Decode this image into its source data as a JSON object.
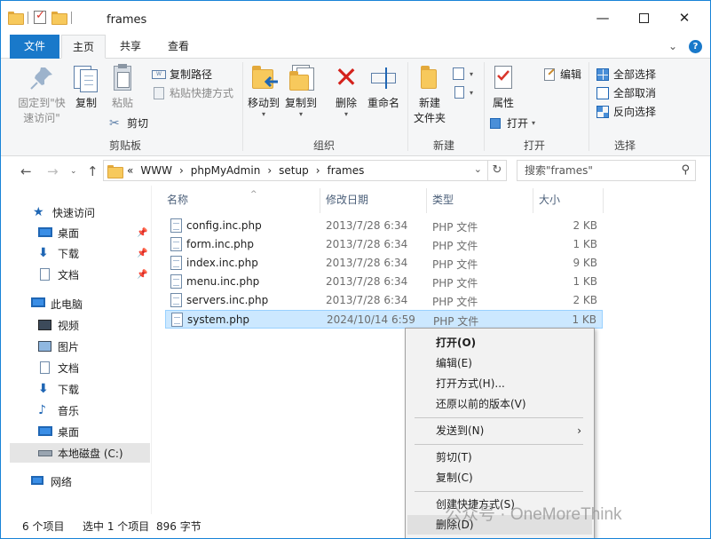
{
  "window": {
    "title": "frames"
  },
  "controls": {
    "min": "—",
    "close": "✕"
  },
  "ribbon_tabs": [
    {
      "label": "文件"
    },
    {
      "label": "主页"
    },
    {
      "label": "共享"
    },
    {
      "label": "查看"
    }
  ],
  "ribbon": {
    "clipboard": {
      "pin_label_1": "固定到\"快",
      "pin_label_2": "速访问\"",
      "copy": "复制",
      "paste": "粘贴",
      "copy_path": "复制路径",
      "paste_shortcut": "粘贴快捷方式",
      "cut": "剪切",
      "group": "剪贴板"
    },
    "organize": {
      "move_to": "移动到",
      "copy_to": "复制到",
      "delete": "删除",
      "rename": "重命名",
      "group": "组织"
    },
    "new": {
      "new_folder_1": "新建",
      "new_folder_2": "文件夹",
      "group": "新建"
    },
    "open": {
      "properties": "属性",
      "open": "打开",
      "edit": "编辑",
      "group": "打开"
    },
    "select": {
      "select_all": "全部选择",
      "select_none": "全部取消",
      "invert": "反向选择",
      "group": "选择"
    }
  },
  "nav": {
    "back": "←",
    "forward": "→",
    "up": "↑",
    "breadcrumb": [
      "«",
      "WWW",
      "›",
      "phpMyAdmin",
      "›",
      "setup",
      "›",
      "frames"
    ],
    "search_placeholder": "搜索\"frames\""
  },
  "sidebar": {
    "items": [
      {
        "label": "快速访问"
      },
      {
        "label": "桌面"
      },
      {
        "label": "下载"
      },
      {
        "label": "文档"
      },
      {
        "label": "此电脑"
      },
      {
        "label": "视频"
      },
      {
        "label": "图片"
      },
      {
        "label": "文档"
      },
      {
        "label": "下载"
      },
      {
        "label": "音乐"
      },
      {
        "label": "桌面"
      },
      {
        "label": "本地磁盘 (C:)"
      },
      {
        "label": "网络"
      }
    ]
  },
  "columns": {
    "name": "名称",
    "date": "修改日期",
    "type": "类型",
    "size": "大小"
  },
  "files": [
    {
      "name": "config.inc.php",
      "date": "2013/7/28 6:34",
      "type": "PHP 文件",
      "size": "2 KB"
    },
    {
      "name": "form.inc.php",
      "date": "2013/7/28 6:34",
      "type": "PHP 文件",
      "size": "1 KB"
    },
    {
      "name": "index.inc.php",
      "date": "2013/7/28 6:34",
      "type": "PHP 文件",
      "size": "9 KB"
    },
    {
      "name": "menu.inc.php",
      "date": "2013/7/28 6:34",
      "type": "PHP 文件",
      "size": "1 KB"
    },
    {
      "name": "servers.inc.php",
      "date": "2013/7/28 6:34",
      "type": "PHP 文件",
      "size": "2 KB"
    },
    {
      "name": "system.php",
      "date": "2024/10/14 6:59",
      "type": "PHP 文件",
      "size": "1 KB"
    }
  ],
  "status": {
    "count": "6 个项目",
    "selected": "选中 1 个项目",
    "size": "896 字节"
  },
  "context_menu": {
    "open": "打开(O)",
    "edit": "编辑(E)",
    "open_with": "打开方式(H)...",
    "restore": "还原以前的版本(V)",
    "send_to": "发送到(N)",
    "cut": "剪切(T)",
    "copy": "复制(C)",
    "create_shortcut": "创建快捷方式(S)",
    "delete": "删除(D)"
  },
  "watermark": "公众号 · OneMoreThink",
  "colors": {
    "accent": "#1979ca",
    "selection": "#cce8ff",
    "selection_border": "#99d1ff"
  }
}
